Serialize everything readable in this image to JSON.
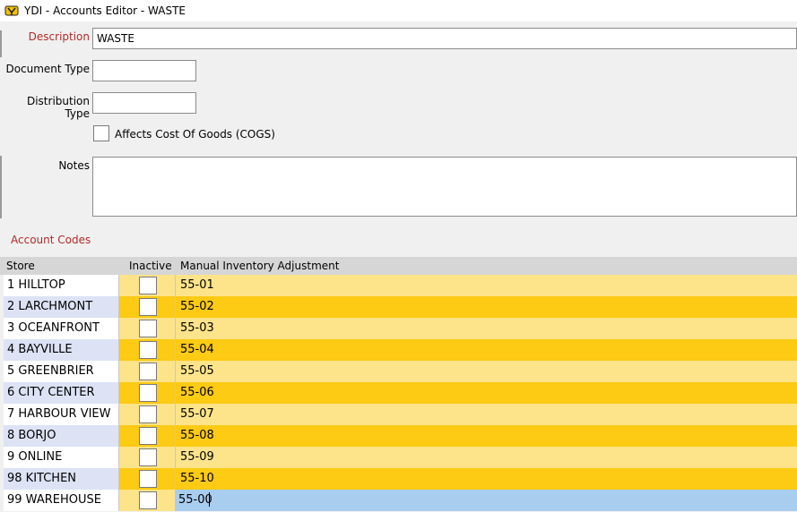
{
  "window": {
    "title": "YDI - Accounts Editor - WASTE"
  },
  "form": {
    "description_label": "Description",
    "description_value": "WASTE",
    "document_type_label": "Document Type",
    "document_type_value": "",
    "distribution_type_label": "Distribution Type",
    "distribution_type_value": "",
    "cogs_label": "Affects Cost Of Goods (COGS)",
    "cogs_checked": false,
    "notes_label": "Notes",
    "notes_value": ""
  },
  "account_codes": {
    "section_title": "Account Codes",
    "columns": {
      "store": "Store",
      "inactive": "Inactive",
      "manual": "Manual Inventory Adjustment"
    },
    "rows": [
      {
        "store": "1 HILLTOP",
        "inactive": false,
        "code": "55-01"
      },
      {
        "store": "2 LARCHMONT",
        "inactive": false,
        "code": "55-02"
      },
      {
        "store": "3 OCEANFRONT",
        "inactive": false,
        "code": "55-03"
      },
      {
        "store": "4 BAYVILLE",
        "inactive": false,
        "code": "55-04"
      },
      {
        "store": "5 GREENBRIER",
        "inactive": false,
        "code": "55-05"
      },
      {
        "store": "6 CITY CENTER",
        "inactive": false,
        "code": "55-06"
      },
      {
        "store": "7 HARBOUR VIEW",
        "inactive": false,
        "code": "55-07"
      },
      {
        "store": "8 BORJO",
        "inactive": false,
        "code": "55-08"
      },
      {
        "store": "9 ONLINE",
        "inactive": false,
        "code": "55-09"
      },
      {
        "store": "98 KITCHEN",
        "inactive": false,
        "code": "55-10"
      },
      {
        "store": "99 WAREHOUSE",
        "inactive": false,
        "code": "55-00"
      }
    ],
    "selected_row": 10
  },
  "colors": {
    "label_red": "#b22a2a",
    "row_light": "#fde38a",
    "row_dark": "#fdca14",
    "store_alt": "#dde3f5",
    "selected": "#a9cdef"
  },
  "icons": {
    "app": "ydi-app-icon"
  }
}
